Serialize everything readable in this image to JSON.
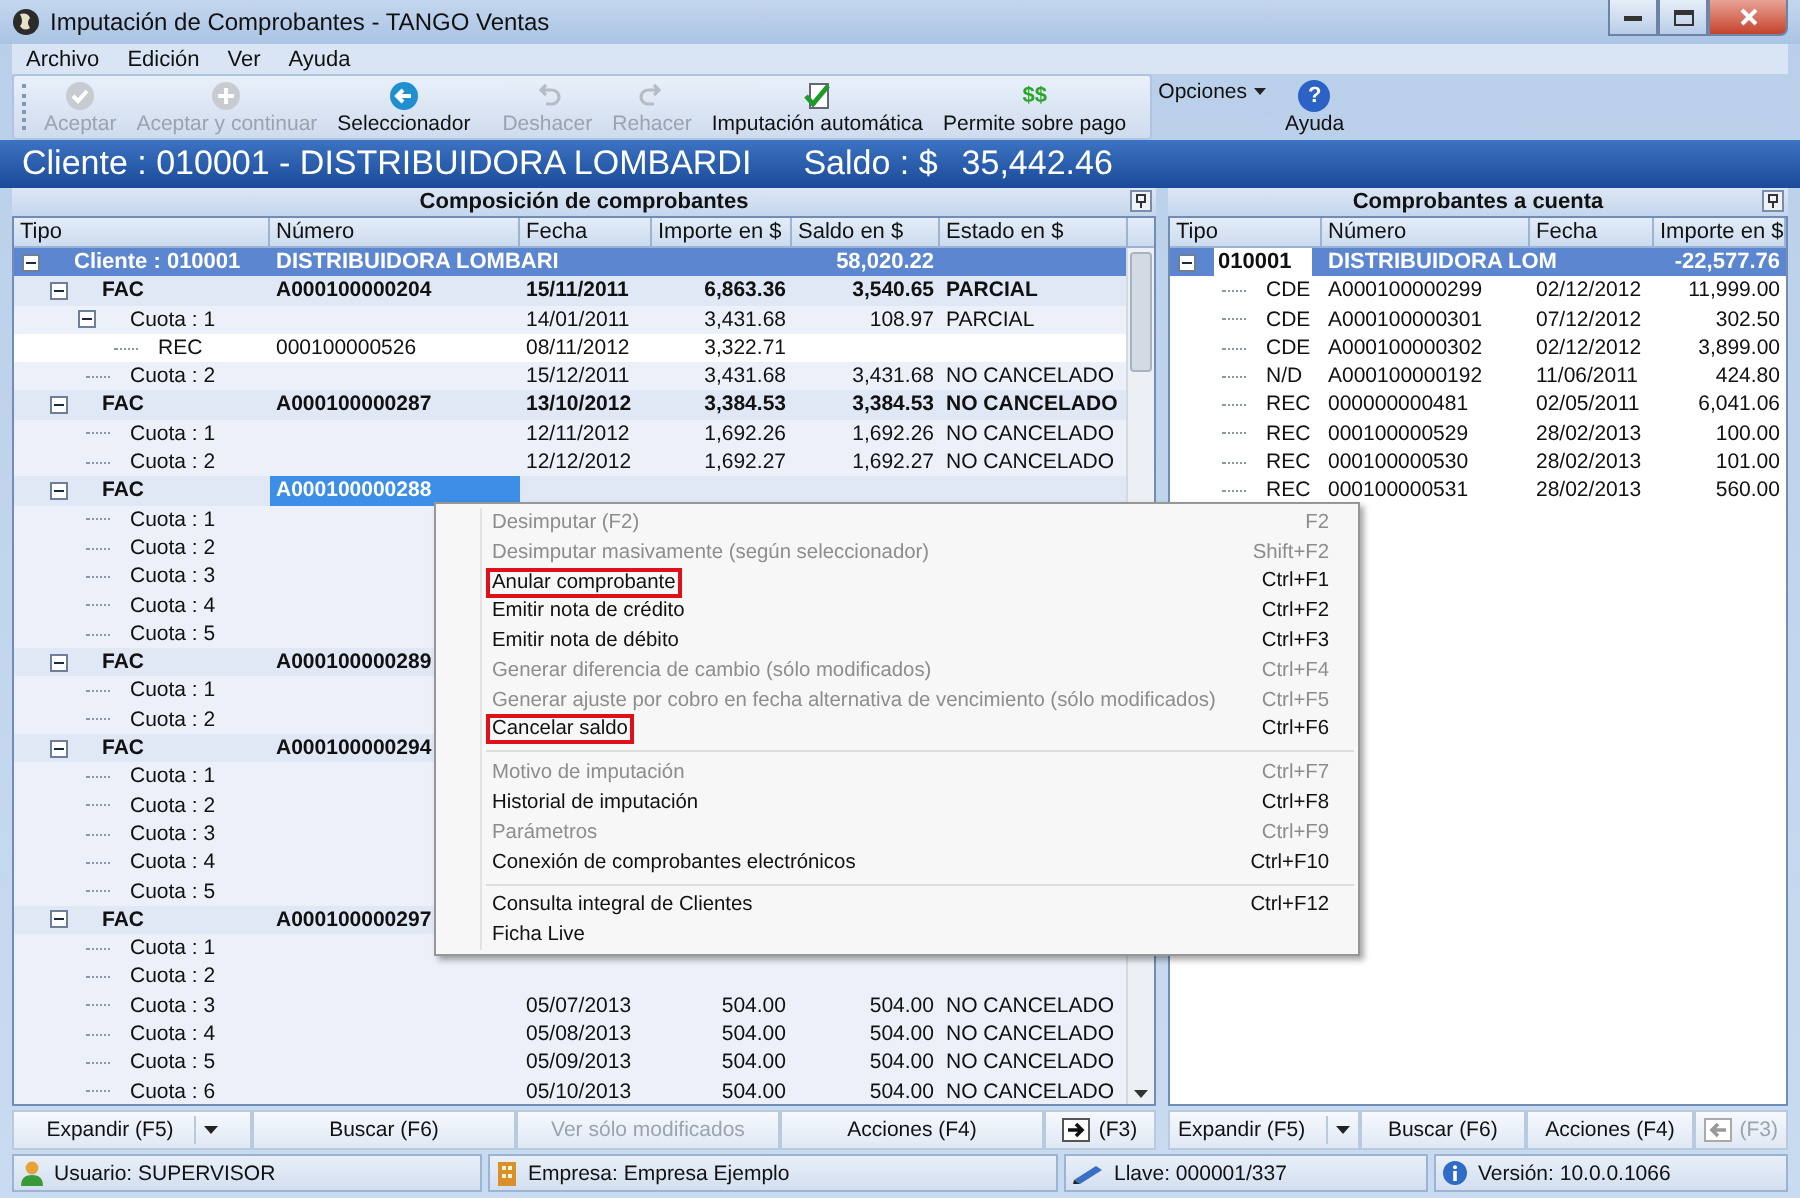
{
  "window": {
    "title": "Imputación de Comprobantes - TANGO Ventas"
  },
  "menu_bar": [
    "Archivo",
    "Edición",
    "Ver",
    "Ayuda"
  ],
  "toolbar": {
    "groups": [
      [
        {
          "label": "Aceptar",
          "disabled": true,
          "kind": "button"
        },
        {
          "label": "Aceptar y continuar",
          "disabled": true,
          "kind": "button"
        },
        {
          "label": "Seleccionador",
          "disabled": false,
          "kind": "button"
        }
      ],
      [
        {
          "label": "Deshacer",
          "disabled": true,
          "kind": "button"
        },
        {
          "label": "Rehacer",
          "disabled": true,
          "kind": "button"
        },
        {
          "label": "Imputación automática",
          "disabled": false,
          "kind": "button"
        },
        {
          "label": "Permite sobre pago",
          "disabled": false,
          "kind": "button",
          "glyph": "$$"
        }
      ],
      [
        {
          "label": "Opciones",
          "disabled": false,
          "kind": "dropdown"
        },
        {
          "label": "Ayuda",
          "disabled": false,
          "kind": "button",
          "glyph": "?"
        }
      ]
    ]
  },
  "banner": {
    "client": "Cliente : 010001 - DISTRIBUIDORA LOMBARDI",
    "balance_label": "Saldo : $",
    "balance": "35,442.46"
  },
  "left_panel": {
    "title": "Composición de comprobantes",
    "columns": [
      "Tipo",
      "Número",
      "Fecha",
      "Importe en $",
      "Saldo en $",
      "Estado en $"
    ],
    "rows": [
      {
        "kind": "client",
        "tipo": "Cliente : 010001",
        "numero": "DISTRIBUIDORA LOMBARI",
        "saldo": "58,020.22",
        "expanded": true,
        "selected": false,
        "children": [
          {
            "kind": "invoice",
            "tipo": "FAC",
            "numero": "A000100000204",
            "fecha": "15/11/2011",
            "importe": "6,863.36",
            "saldo": "3,540.65",
            "estado": "PARCIAL",
            "expanded": true,
            "selected": false,
            "children": [
              {
                "kind": "installment",
                "tipo": "Cuota : 1",
                "fecha": "14/01/2011",
                "importe": "3,431.68",
                "saldo": "108.97",
                "estado": "PARCIAL",
                "expanded": true,
                "selected": false,
                "children": [
                  {
                    "kind": "receipt",
                    "tipo": "REC",
                    "numero": "000100000526",
                    "fecha": "08/11/2012",
                    "importe": "3,322.71",
                    "selected": false
                  }
                ]
              },
              {
                "kind": "installment",
                "tipo": "Cuota : 2",
                "fecha": "15/12/2011",
                "importe": "3,431.68",
                "saldo": "3,431.68",
                "estado": "NO CANCELADO",
                "selected": false
              }
            ]
          },
          {
            "kind": "invoice",
            "tipo": "FAC",
            "numero": "A000100000287",
            "fecha": "13/10/2012",
            "importe": "3,384.53",
            "saldo": "3,384.53",
            "estado": "NO CANCELADO",
            "expanded": true,
            "selected": false,
            "children": [
              {
                "kind": "installment",
                "tipo": "Cuota : 1",
                "fecha": "12/11/2012",
                "importe": "1,692.26",
                "saldo": "1,692.26",
                "estado": "NO CANCELADO",
                "selected": false
              },
              {
                "kind": "installment",
                "tipo": "Cuota : 2",
                "fecha": "12/12/2012",
                "importe": "1,692.27",
                "saldo": "1,692.27",
                "estado": "NO CANCELADO",
                "selected": false
              }
            ]
          },
          {
            "kind": "invoice",
            "tipo": "FAC",
            "numero": "A000100000288",
            "expanded": true,
            "selected": true,
            "children": [
              {
                "kind": "installment",
                "tipo": "Cuota : 1",
                "selected": false
              },
              {
                "kind": "installment",
                "tipo": "Cuota : 2",
                "selected": false
              },
              {
                "kind": "installment",
                "tipo": "Cuota : 3",
                "selected": false
              },
              {
                "kind": "installment",
                "tipo": "Cuota : 4",
                "selected": false
              },
              {
                "kind": "installment",
                "tipo": "Cuota : 5",
                "selected": false
              }
            ]
          },
          {
            "kind": "invoice",
            "tipo": "FAC",
            "numero": "A000100000289",
            "expanded": true,
            "selected": false,
            "children": [
              {
                "kind": "installment",
                "tipo": "Cuota : 1",
                "selected": false
              },
              {
                "kind": "installment",
                "tipo": "Cuota : 2",
                "selected": false
              }
            ]
          },
          {
            "kind": "invoice",
            "tipo": "FAC",
            "numero": "A000100000294",
            "expanded": true,
            "selected": false,
            "children": [
              {
                "kind": "installment",
                "tipo": "Cuota : 1",
                "selected": false
              },
              {
                "kind": "installment",
                "tipo": "Cuota : 2",
                "selected": false
              },
              {
                "kind": "installment",
                "tipo": "Cuota : 3",
                "selected": false
              },
              {
                "kind": "installment",
                "tipo": "Cuota : 4",
                "selected": false
              },
              {
                "kind": "installment",
                "tipo": "Cuota : 5",
                "selected": false
              }
            ]
          },
          {
            "kind": "invoice",
            "tipo": "FAC",
            "numero": "A000100000297",
            "expanded": true,
            "selected": false,
            "children": [
              {
                "kind": "installment",
                "tipo": "Cuota : 1",
                "selected": false
              },
              {
                "kind": "installment",
                "tipo": "Cuota : 2",
                "selected": false
              },
              {
                "kind": "installment",
                "tipo": "Cuota : 3",
                "fecha": "05/07/2013",
                "importe": "504.00",
                "saldo": "504.00",
                "estado": "NO CANCELADO",
                "selected": false
              },
              {
                "kind": "installment",
                "tipo": "Cuota : 4",
                "fecha": "05/08/2013",
                "importe": "504.00",
                "saldo": "504.00",
                "estado": "NO CANCELADO",
                "selected": false
              },
              {
                "kind": "installment",
                "tipo": "Cuota : 5",
                "fecha": "05/09/2013",
                "importe": "504.00",
                "saldo": "504.00",
                "estado": "NO CANCELADO",
                "selected": false
              },
              {
                "kind": "installment",
                "tipo": "Cuota : 6",
                "fecha": "05/10/2013",
                "importe": "504.00",
                "saldo": "504.00",
                "estado": "NO CANCELADO",
                "selected": false
              }
            ]
          }
        ]
      }
    ],
    "footer": [
      {
        "label": "Expandir (F5)",
        "kind": "split",
        "disabled": false
      },
      {
        "label": "Buscar (F6)",
        "kind": "button",
        "disabled": false
      },
      {
        "label": "Ver sólo modificados",
        "kind": "button",
        "disabled": true
      },
      {
        "label": "Acciones (F4)",
        "kind": "button",
        "disabled": false
      },
      {
        "label": "(F3)",
        "kind": "arrow_right",
        "disabled": false
      }
    ]
  },
  "right_panel": {
    "title": "Comprobantes a cuenta",
    "columns": [
      "Tipo",
      "Número",
      "Fecha",
      "Importe en $"
    ],
    "rows": [
      {
        "kind": "client",
        "tipo": "010001",
        "numero": "DISTRIBUIDORA LOM",
        "importe": "-22,577.76",
        "expanded": true,
        "children": [
          {
            "kind": "entry",
            "tipo": "CDE",
            "numero": "A000100000299",
            "fecha": "02/12/2012",
            "importe": "11,999.00"
          },
          {
            "kind": "entry",
            "tipo": "CDE",
            "numero": "A000100000301",
            "fecha": "07/12/2012",
            "importe": "302.50"
          },
          {
            "kind": "entry",
            "tipo": "CDE",
            "numero": "A000100000302",
            "fecha": "02/12/2012",
            "importe": "3,899.00"
          },
          {
            "kind": "entry",
            "tipo": "N/D",
            "numero": "A000100000192",
            "fecha": "11/06/2011",
            "importe": "424.80"
          },
          {
            "kind": "entry",
            "tipo": "REC",
            "numero": "000000000481",
            "fecha": "02/05/2011",
            "importe": "6,041.06"
          },
          {
            "kind": "entry",
            "tipo": "REC",
            "numero": "000100000529",
            "fecha": "28/02/2013",
            "importe": "100.00"
          },
          {
            "kind": "entry",
            "tipo": "REC",
            "numero": "000100000530",
            "fecha": "28/02/2013",
            "importe": "101.00"
          },
          {
            "kind": "entry",
            "tipo": "REC",
            "numero": "000100000531",
            "fecha": "28/02/2013",
            "importe": "560.00"
          }
        ]
      }
    ],
    "footer": [
      {
        "label": "Expandir (F5)",
        "kind": "split",
        "disabled": false
      },
      {
        "label": "Buscar (F6)",
        "kind": "button",
        "disabled": false
      },
      {
        "label": "Acciones (F4)",
        "kind": "button",
        "disabled": false
      },
      {
        "label": "(F3)",
        "kind": "arrow_left",
        "disabled": true
      }
    ]
  },
  "context_menu": {
    "groups": [
      [
        {
          "label": "Desimputar (F2)",
          "shortcut": "F2",
          "disabled": true,
          "outlined": false
        },
        {
          "label": "Desimputar masivamente (según seleccionador)",
          "shortcut": "Shift+F2",
          "disabled": true,
          "outlined": false
        },
        {
          "label": "Anular comprobante",
          "shortcut": "Ctrl+F1",
          "disabled": false,
          "outlined": true
        },
        {
          "label": "Emitir nota de crédito",
          "shortcut": "Ctrl+F2",
          "disabled": false,
          "outlined": false
        },
        {
          "label": "Emitir nota de débito",
          "shortcut": "Ctrl+F3",
          "disabled": false,
          "outlined": false
        },
        {
          "label": "Generar diferencia de cambio (sólo modificados)",
          "shortcut": "Ctrl+F4",
          "disabled": true,
          "outlined": false
        },
        {
          "label": "Generar ajuste por cobro en fecha alternativa de vencimiento (sólo modificados)",
          "shortcut": "Ctrl+F5",
          "disabled": true,
          "outlined": false
        },
        {
          "label": "Cancelar saldo",
          "shortcut": "Ctrl+F6",
          "disabled": false,
          "outlined": true
        }
      ],
      [
        {
          "label": "Motivo de imputación",
          "shortcut": "Ctrl+F7",
          "disabled": true,
          "outlined": false
        },
        {
          "label": "Historial de imputación",
          "shortcut": "Ctrl+F8",
          "disabled": false,
          "outlined": false
        },
        {
          "label": "Parámetros",
          "shortcut": "Ctrl+F9",
          "disabled": true,
          "outlined": false
        },
        {
          "label": "Conexión de comprobantes electrónicos",
          "shortcut": "Ctrl+F10",
          "disabled": false,
          "outlined": false
        }
      ],
      [
        {
          "label": "Consulta integral de Clientes",
          "shortcut": "Ctrl+F12",
          "disabled": false,
          "outlined": false
        },
        {
          "label": "Ficha Live",
          "disabled": false,
          "outlined": false
        }
      ]
    ]
  },
  "status_bar": [
    "Usuario: SUPERVISOR",
    "Empresa: Empresa Ejemplo",
    "Llave: 000001/337",
    "Versión: 10.0.0.1066"
  ]
}
